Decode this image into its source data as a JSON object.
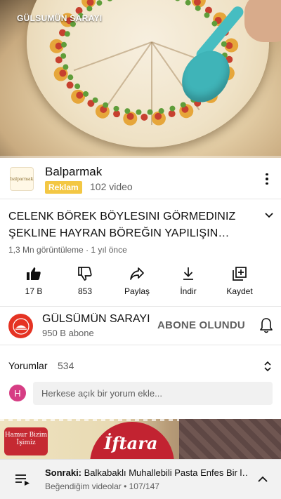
{
  "player": {
    "watermark": "GÜLSUMÜN SARAYI",
    "progress": 0.0
  },
  "ad": {
    "advertiser": "Balparmak",
    "badge": "Reklam",
    "video_count": "102 video",
    "logo_text": "balparmak"
  },
  "video": {
    "title": "CELENK BÖREK BÖYLESINI GÖRMEDINIZ ŞEKLINE HAYRAN BÖREĞIN YAPILIŞIN…",
    "meta": "1,3 Mn görüntüleme · 1 yıl önce"
  },
  "actions": {
    "like": "17 B",
    "dislike": "853",
    "share": "Paylaş",
    "download": "İndir",
    "save": "Kaydet"
  },
  "channel": {
    "name": "GÜLSÜMÜN SARAYI",
    "subscribers": "950 B abone",
    "subscribe_label": "ABONE OLUNDU"
  },
  "comments": {
    "heading": "Yorumlar",
    "count": "534",
    "avatar_letter": "H",
    "placeholder": "Herkese açık bir yorum ekle..."
  },
  "banner": {
    "tag_text": "Hamur Bizim İşimiz",
    "headline": "İftara"
  },
  "up_next": {
    "prefix": "Sonraki:",
    "title": "Balkabaklı Muhallebili  Pasta Enfes Bir l…",
    "playlist": "Beğendiğim videolar • 107/147"
  },
  "colors": {
    "accent_red": "#ff0000",
    "ad_badge": "#f3c744",
    "channel_avatar": "#e53323",
    "comment_avatar": "#d63d84"
  }
}
